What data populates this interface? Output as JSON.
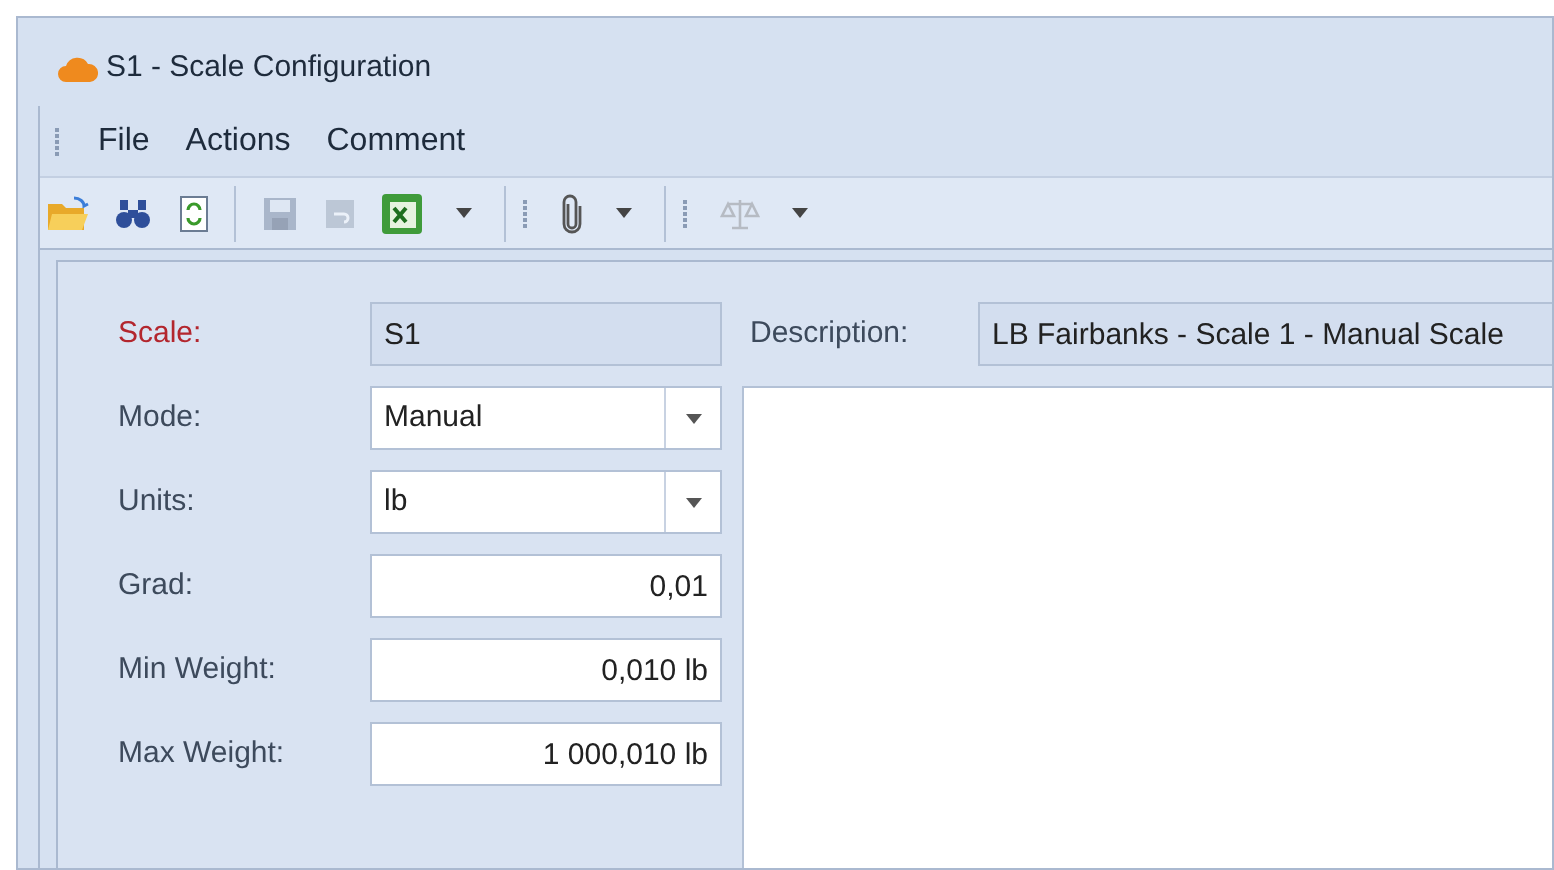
{
  "window": {
    "title": "S1 - Scale Configuration"
  },
  "menu": [
    "File",
    "Actions",
    "Comment"
  ],
  "toolbar": [
    {
      "kind": "open",
      "disabled": false
    },
    {
      "kind": "find",
      "disabled": false
    },
    {
      "kind": "refresh",
      "disabled": false
    },
    {
      "kind": "separator"
    },
    {
      "kind": "save",
      "disabled": true
    },
    {
      "kind": "undo",
      "disabled": true
    },
    {
      "kind": "excel",
      "disabled": false
    },
    {
      "kind": "dropdown",
      "disabled": false
    },
    {
      "kind": "grip"
    },
    {
      "kind": "attach",
      "disabled": false
    },
    {
      "kind": "dropdown",
      "disabled": false
    },
    {
      "kind": "grip"
    },
    {
      "kind": "balance",
      "disabled": true
    },
    {
      "kind": "dropdown",
      "disabled": false
    }
  ],
  "fields": [
    {
      "label": "Scale:",
      "value": "S1",
      "kind": "readonly",
      "required": true
    },
    {
      "label": "Mode:",
      "value": "Manual",
      "kind": "combo",
      "required": false
    },
    {
      "label": "Units:",
      "value": "lb",
      "kind": "combo",
      "required": false
    },
    {
      "label": "Grad:",
      "value": "0,01",
      "kind": "number",
      "required": false
    },
    {
      "label": "Min Weight:",
      "value": "0,010 lb",
      "kind": "number",
      "required": false
    },
    {
      "label": "Max Weight:",
      "value": "1 000,010 lb",
      "kind": "number",
      "required": false
    }
  ],
  "description": {
    "label": "Description:",
    "value": "LB Fairbanks - Scale 1 - Manual Scale"
  }
}
